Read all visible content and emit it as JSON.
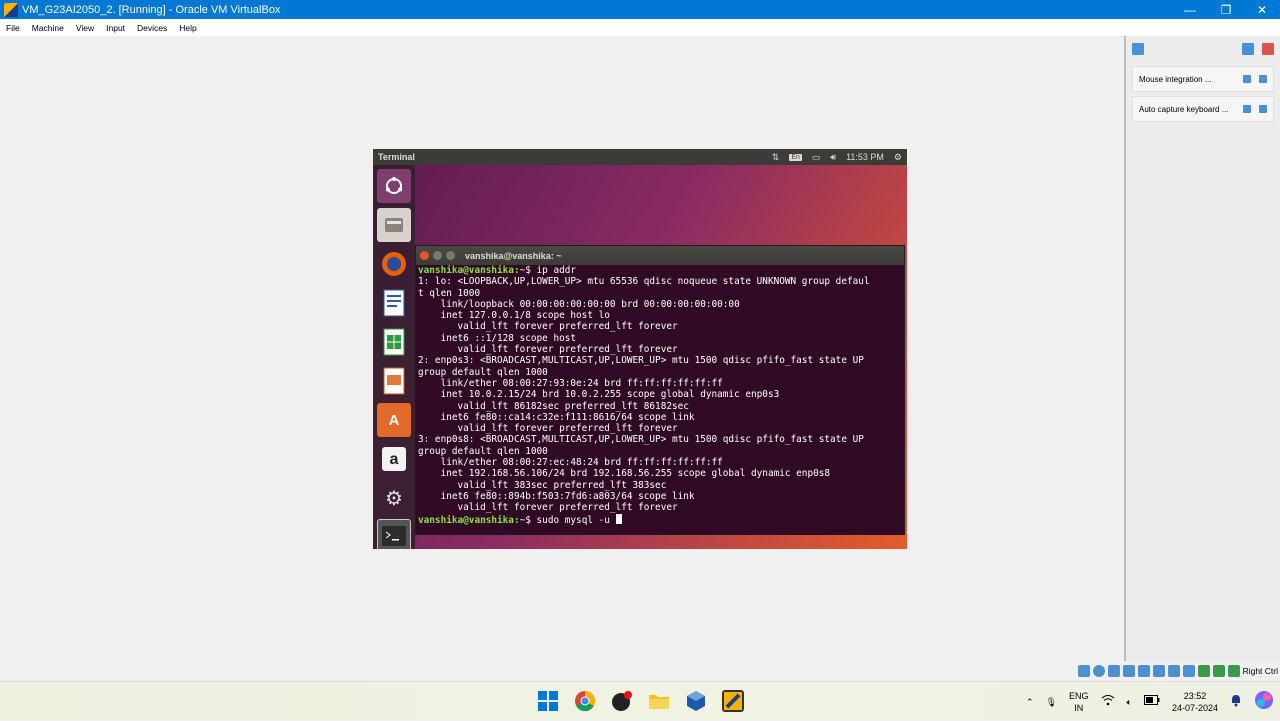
{
  "window": {
    "title": "VM_G23AI2050_2. [Running] - Oracle VM VirtualBox",
    "minimize": "—",
    "restore": "❐",
    "close": "✕"
  },
  "menu": [
    "File",
    "Machine",
    "View",
    "Input",
    "Devices",
    "Help"
  ],
  "side_panel": {
    "notifications": [
      {
        "label": "Mouse integration ..."
      },
      {
        "label": "Auto capture keyboard ..."
      }
    ]
  },
  "status_bar": {
    "host_key": "Right Ctrl"
  },
  "guest": {
    "topbar": {
      "title": "Terminal",
      "lang": "En",
      "time": "11:53 PM"
    },
    "terminal": {
      "title": "vanshika@vanshika: ~",
      "prompt": "vanshika@vanshika:",
      "lines": [
        {
          "prompt": "vanshika@vanshika:",
          "text": "~$ ip addr"
        },
        {
          "text": "1: lo: <LOOPBACK,UP,LOWER_UP> mtu 65536 qdisc noqueue state UNKNOWN group defaul"
        },
        {
          "text": "t qlen 1000"
        },
        {
          "text": "    link/loopback 00:00:00:00:00:00 brd 00:00:00:00:00:00"
        },
        {
          "text": "    inet 127.0.0.1/8 scope host lo"
        },
        {
          "text": "       valid_lft forever preferred_lft forever"
        },
        {
          "text": "    inet6 ::1/128 scope host"
        },
        {
          "text": "       valid_lft forever preferred_lft forever"
        },
        {
          "text": "2: enp0s3: <BROADCAST,MULTICAST,UP,LOWER_UP> mtu 1500 qdisc pfifo_fast state UP"
        },
        {
          "text": "group default qlen 1000"
        },
        {
          "text": "    link/ether 08:00:27:93:0e:24 brd ff:ff:ff:ff:ff:ff"
        },
        {
          "text": "    inet 10.0.2.15/24 brd 10.0.2.255 scope global dynamic enp0s3"
        },
        {
          "text": "       valid_lft 86182sec preferred_lft 86182sec"
        },
        {
          "text": "    inet6 fe80::ca14:c32e:f111:8616/64 scope link"
        },
        {
          "text": "       valid_lft forever preferred_lft forever"
        },
        {
          "text": "3: enp0s8: <BROADCAST,MULTICAST,UP,LOWER_UP> mtu 1500 qdisc pfifo_fast state UP"
        },
        {
          "text": "group default qlen 1000"
        },
        {
          "text": "    link/ether 08:00:27:ec:48:24 brd ff:ff:ff:ff:ff:ff"
        },
        {
          "text": "    inet 192.168.56.106/24 brd 192.168.56.255 scope global dynamic enp0s8"
        },
        {
          "text": "       valid_lft 383sec preferred_lft 383sec"
        },
        {
          "text": "    inet6 fe80::894b:f503:7fd6:a803/64 scope link"
        },
        {
          "text": "       valid_lft forever preferred_lft forever"
        },
        {
          "prompt": "vanshika@vanshika:",
          "text": "~$ sudo mysql -u ",
          "cursor": true
        }
      ]
    }
  },
  "taskbar": {
    "lang_top": "ENG",
    "lang_bottom": "IN",
    "time": "23:52",
    "date": "24-07-2024"
  }
}
